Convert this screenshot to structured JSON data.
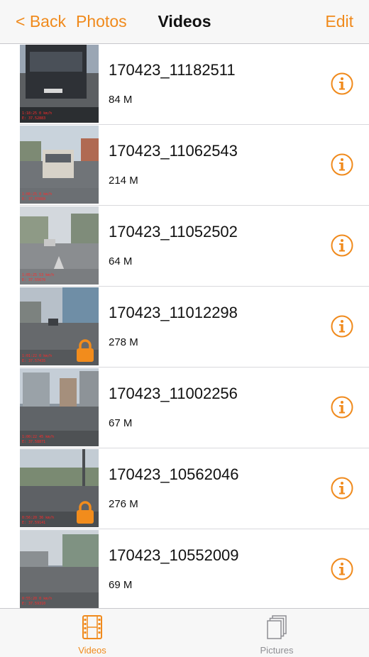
{
  "nav": {
    "back_label": "< Back",
    "photos_label": "Photos",
    "title": "Videos",
    "edit_label": "Edit"
  },
  "colors": {
    "accent": "#f08a1c",
    "inactive": "#8e8e93"
  },
  "videos": [
    {
      "name": "170423_11182511",
      "size": "84 M",
      "locked": false
    },
    {
      "name": "170423_11062543",
      "size": "214 M",
      "locked": false
    },
    {
      "name": "170423_11052502",
      "size": "64 M",
      "locked": false
    },
    {
      "name": "170423_11012298",
      "size": "278 M",
      "locked": true
    },
    {
      "name": "170423_11002256",
      "size": "67 M",
      "locked": false
    },
    {
      "name": "170423_10562046",
      "size": "276 M",
      "locked": true
    },
    {
      "name": "170423_10552009",
      "size": "69 M",
      "locked": false
    }
  ],
  "icons": {
    "info": "info-circle-icon",
    "lock": "lock-icon",
    "videos_tab": "film-strip-icon",
    "pictures_tab": "photo-stack-icon"
  },
  "tabbar": {
    "videos_label": "Videos",
    "pictures_label": "Pictures",
    "selected": "Videos"
  }
}
